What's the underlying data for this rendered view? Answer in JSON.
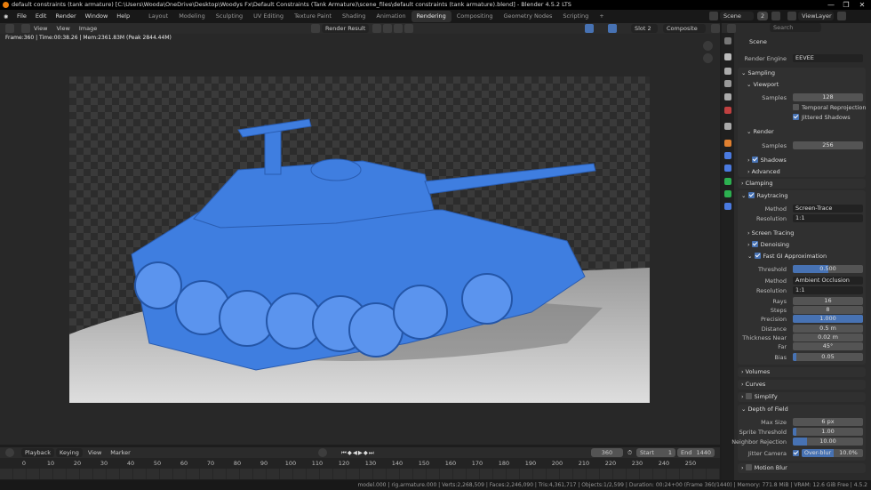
{
  "window": {
    "title": "default constraints (tank armature) [C:\\Users\\Wooda\\OneDrive\\Desktop\\Woodys Fx\\Default Constraints (Tank Armature)\\scene_files\\default constraints (tank armature).blend] - Blender 4.5.2 LTS",
    "minimize": "—",
    "maximize": "❐",
    "close": "✕"
  },
  "menu": [
    "File",
    "Edit",
    "Render",
    "Window",
    "Help"
  ],
  "workspaces": [
    "Layout",
    "Modeling",
    "Sculpting",
    "UV Editing",
    "Texture Paint",
    "Shading",
    "Animation",
    "Rendering",
    "Compositing",
    "Geometry Nodes",
    "Scripting",
    "+"
  ],
  "active_workspace": "Rendering",
  "scene": {
    "name": "Scene",
    "users": "2",
    "view_layer": "ViewLayer"
  },
  "image_editor": {
    "view_menu": "View",
    "menu": [
      "View",
      "Image"
    ],
    "image_name": "Render Result",
    "slot": "Slot 2",
    "pass": "Composite",
    "info": "Frame:360 | Time:00:38.26 | Mem:2361.83M (Peak 2844.44M)"
  },
  "properties": {
    "search_placeholder": "Search",
    "context": "Scene",
    "render_engine_label": "Render Engine",
    "render_engine": "EEVEE",
    "sampling": "Sampling",
    "viewport": "Viewport",
    "samples_label": "Samples",
    "viewport_samples": "128",
    "temporal_reprojection": "Temporal Reprojection",
    "jittered_shadows": "Jittered Shadows",
    "render": "Render",
    "render_samples": "256",
    "shadows": "Shadows",
    "advanced": "Advanced",
    "clamping": "Clamping",
    "raytracing": "Raytracing",
    "method_label": "Method",
    "method": "Screen-Trace",
    "resolution_label": "Resolution",
    "resolution": "1:1",
    "screen_tracing": "Screen Tracing",
    "denoising": "Denoising",
    "fast_gi": "Fast GI Approximation",
    "threshold_label": "Threshold",
    "threshold": "0.500",
    "threshold_frac": 0.5,
    "gi_method": "Ambient Occlusion",
    "gi_resolution": "1:1",
    "rays_label": "Rays",
    "rays": "16",
    "steps_label": "Steps",
    "steps": "8",
    "precision_label": "Precision",
    "precision": "1.000",
    "precision_frac": 1.0,
    "distance_label": "Distance",
    "distance": "0.5 m",
    "thickness_near_label": "Thickness Near",
    "thickness_near": "0.02 m",
    "far_label": "Far",
    "far": "45°",
    "bias_label": "Bias",
    "bias": "0.05",
    "bias_frac": 0.05,
    "volumes": "Volumes",
    "curves": "Curves",
    "simplify": "Simplify",
    "dof": "Depth of Field",
    "max_size_label": "Max Size",
    "max_size": "6 px",
    "sprite_threshold_label": "Sprite Threshold",
    "sprite_threshold": "1.00",
    "sprite_frac": 0.05,
    "neighbor_rejection_label": "Neighbor Rejection",
    "neighbor_rejection": "10.00",
    "neighbor_frac": 0.2,
    "jitter_camera_label": "Jitter Camera",
    "overblur_label": "Over-blur",
    "overblur": "10.0%",
    "motion_blur": "Motion Blur"
  },
  "timeline": {
    "menus": [
      "Playback",
      "Keying",
      "View",
      "Marker"
    ],
    "current_frame": "360",
    "start_label": "Start",
    "start": "1",
    "end_label": "End",
    "end": "1440",
    "ticks": [
      "0",
      "10",
      "20",
      "30",
      "40",
      "50",
      "60",
      "70",
      "80",
      "90",
      "100",
      "110",
      "120",
      "130",
      "140",
      "150",
      "160",
      "170",
      "180",
      "190",
      "200",
      "210",
      "220",
      "230",
      "240",
      "250"
    ]
  },
  "status": "model.000 | rig.armature.000 | Verts:2,268,509 | Faces:2,246,090 | Tris:4,361,717 | Objects:1/2,599 | Duration: 00:24+00 (Frame 360/1440) | Memory: 771.8 MiB | VRAM: 12.6 GiB Free | 4.5.2",
  "colors": {
    "accent": "#4772b3",
    "tank": "#3f7ee0"
  }
}
